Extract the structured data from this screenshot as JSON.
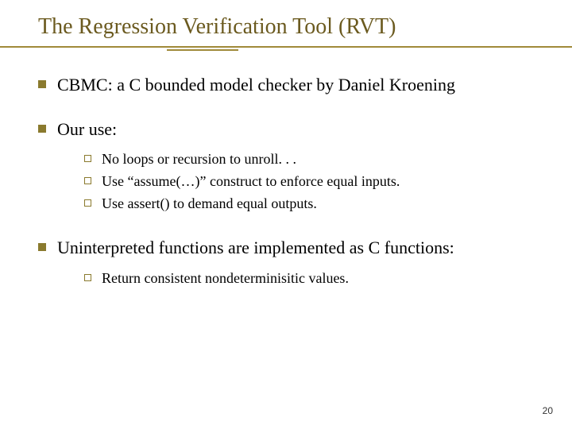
{
  "title": "The Regression Verification Tool (RVT)",
  "bullets": [
    {
      "text": "CBMC: a C bounded model checker by Daniel Kroening",
      "sub": []
    },
    {
      "text": "Our use:",
      "sub": [
        "No loops or recursion to unroll. . .",
        "Use “assume(…)” construct to enforce equal inputs.",
        "Use assert() to demand equal outputs."
      ]
    },
    {
      "text": "Uninterpreted functions are implemented as C functions:",
      "sub": [
        "Return consistent nondeterminisitic values."
      ]
    }
  ],
  "page_number": "20"
}
